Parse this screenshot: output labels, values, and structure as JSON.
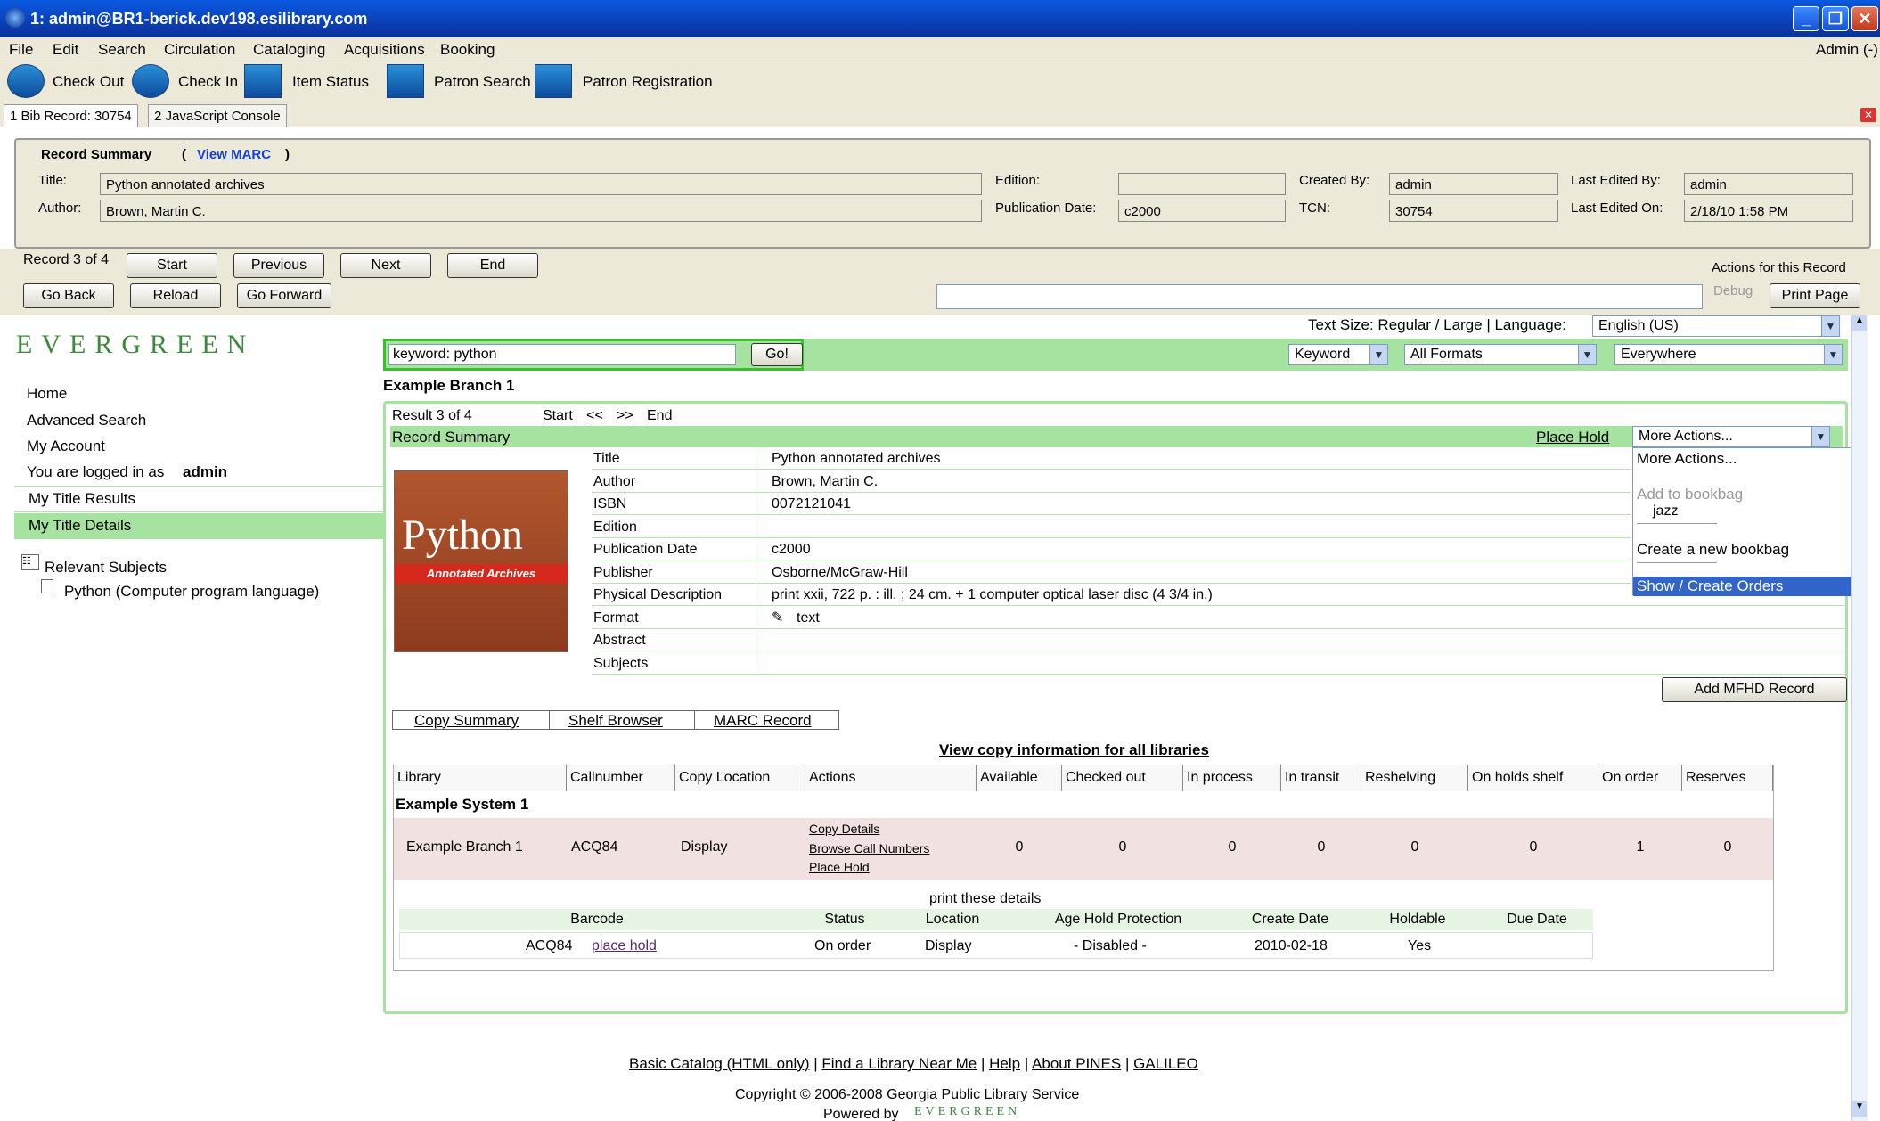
{
  "window": {
    "title": "1: admin@BR1-berick.dev198.esilibrary.com",
    "user": "Admin (-)"
  },
  "menu": [
    "File",
    "Edit",
    "Search",
    "Circulation",
    "Cataloging",
    "Acquisitions",
    "Booking"
  ],
  "toolbar": {
    "checkout": "Check Out",
    "checkin": "Check In",
    "item_status": "Item Status",
    "patron_search": "Patron Search",
    "patron_registration": "Patron Registration"
  },
  "tabs": [
    "1 Bib Record: 30754",
    "2 JavaScript Console"
  ],
  "summary": {
    "header": "Record Summary",
    "header_open": "(",
    "view_marc": "View MARC",
    "header_close": ")",
    "title_label": "Title:",
    "title": "Python annotated archives",
    "author_label": "Author:",
    "author": "Brown, Martin C.",
    "edition_label": "Edition:",
    "edition": "",
    "pubdate_label": "Publication Date:",
    "pubdate": "c2000",
    "created_by_label": "Created By:",
    "created_by": "admin",
    "tcn_label": "TCN:",
    "tcn": "30754",
    "last_edited_by_label": "Last Edited By:",
    "last_edited_by": "admin",
    "last_edited_on_label": "Last Edited On:",
    "last_edited_on": "2/18/10 1:58 PM"
  },
  "nav": {
    "record_of": "Record 3 of 4",
    "start": "Start",
    "previous": "Previous",
    "next": "Next",
    "end": "End",
    "go_back": "Go Back",
    "reload": "Reload",
    "go_forward": "Go Forward",
    "actions_label": "Actions for this Record",
    "debug": "Debug",
    "print_page": "Print Page"
  },
  "opac": {
    "text_size": "Text Size: Regular / Large | Language:",
    "language": "English (US)",
    "logo": "EVERGREEN",
    "search_value": "keyword: python",
    "go": "Go!",
    "search_type": "Keyword",
    "format": "All Formats",
    "location": "Everywhere",
    "branch": "Example Branch 1",
    "sidebar": {
      "home": "Home",
      "advanced": "Advanced Search",
      "account": "My Account",
      "logged_prefix": "You are logged in as",
      "logged_user": "admin",
      "title_results": "My Title Results",
      "title_details": "My Title Details",
      "relevant": "Relevant Subjects",
      "subject": "Python (Computer program language)"
    },
    "result": {
      "result_of": "Result 3 of 4",
      "start": "Start",
      "prev": "<<",
      "next": ">>",
      "end": "End",
      "record_summary": "Record Summary",
      "place_hold": "Place Hold",
      "more_actions": "More Actions..."
    },
    "dropdown": {
      "item1": "More Actions...",
      "add_bookbag": "Add to bookbag",
      "jazz": "jazz",
      "create_bookbag": "Create a new bookbag",
      "show_orders": "Show / Create Orders"
    },
    "cover": {
      "title": "Python",
      "subtitle": "Annotated Archives"
    },
    "record": [
      {
        "k": "Title",
        "v": "Python annotated archives"
      },
      {
        "k": "Author",
        "v": "Brown, Martin C."
      },
      {
        "k": "ISBN",
        "v": "0072121041"
      },
      {
        "k": "Edition",
        "v": ""
      },
      {
        "k": "Publication Date",
        "v": "c2000"
      },
      {
        "k": "Publisher",
        "v": "Osborne/McGraw-Hill"
      },
      {
        "k": "Physical Description",
        "v": "print xxii, 722 p. : ill. ; 24 cm. + 1 computer optical laser disc (4 3/4 in.)"
      },
      {
        "k": "Format",
        "v": "text"
      },
      {
        "k": "Abstract",
        "v": ""
      },
      {
        "k": "Subjects",
        "v": ""
      }
    ],
    "add_mfhd": "Add MFHD Record",
    "subtabs": {
      "copy_summary": "Copy Summary",
      "shelf_browser": "Shelf Browser",
      "marc_record": "MARC Record"
    },
    "view_all": "View copy information for all libraries",
    "holdings_headers": [
      "Library",
      "Callnumber",
      "Copy Location",
      "Actions",
      "Available",
      "Checked out",
      "In process",
      "In transit",
      "Reshelving",
      "On holds shelf",
      "On order",
      "Reserves"
    ],
    "system": "Example System 1",
    "holding": {
      "library": "Example Branch 1",
      "callnumber": "ACQ84",
      "location": "Display",
      "copy_details": "Copy Details",
      "browse_call": "Browse Call Numbers",
      "place_hold": "Place Hold",
      "counts": [
        "0",
        "0",
        "0",
        "0",
        "0",
        "0",
        "1",
        "0"
      ]
    },
    "print_details": "print these details",
    "detail_headers": [
      "Barcode",
      "Status",
      "Location",
      "Age Hold Protection",
      "Create Date",
      "Holdable",
      "Due Date"
    ],
    "detail": {
      "barcode": "ACQ84",
      "place_hold": "place hold",
      "status": "On order",
      "location": "Display",
      "age": "- Disabled -",
      "create": "2010-02-18",
      "holdable": "Yes",
      "due": ""
    },
    "footer": {
      "basic": "Basic Catalog (HTML only)",
      "sep": "|",
      "find": "Find a Library Near Me",
      "help": "Help",
      "about": "About PINES",
      "galileo": "GALILEO",
      "copyright": "Copyright © 2006-2008 Georgia Public Library Service",
      "powered": "Powered by"
    }
  }
}
